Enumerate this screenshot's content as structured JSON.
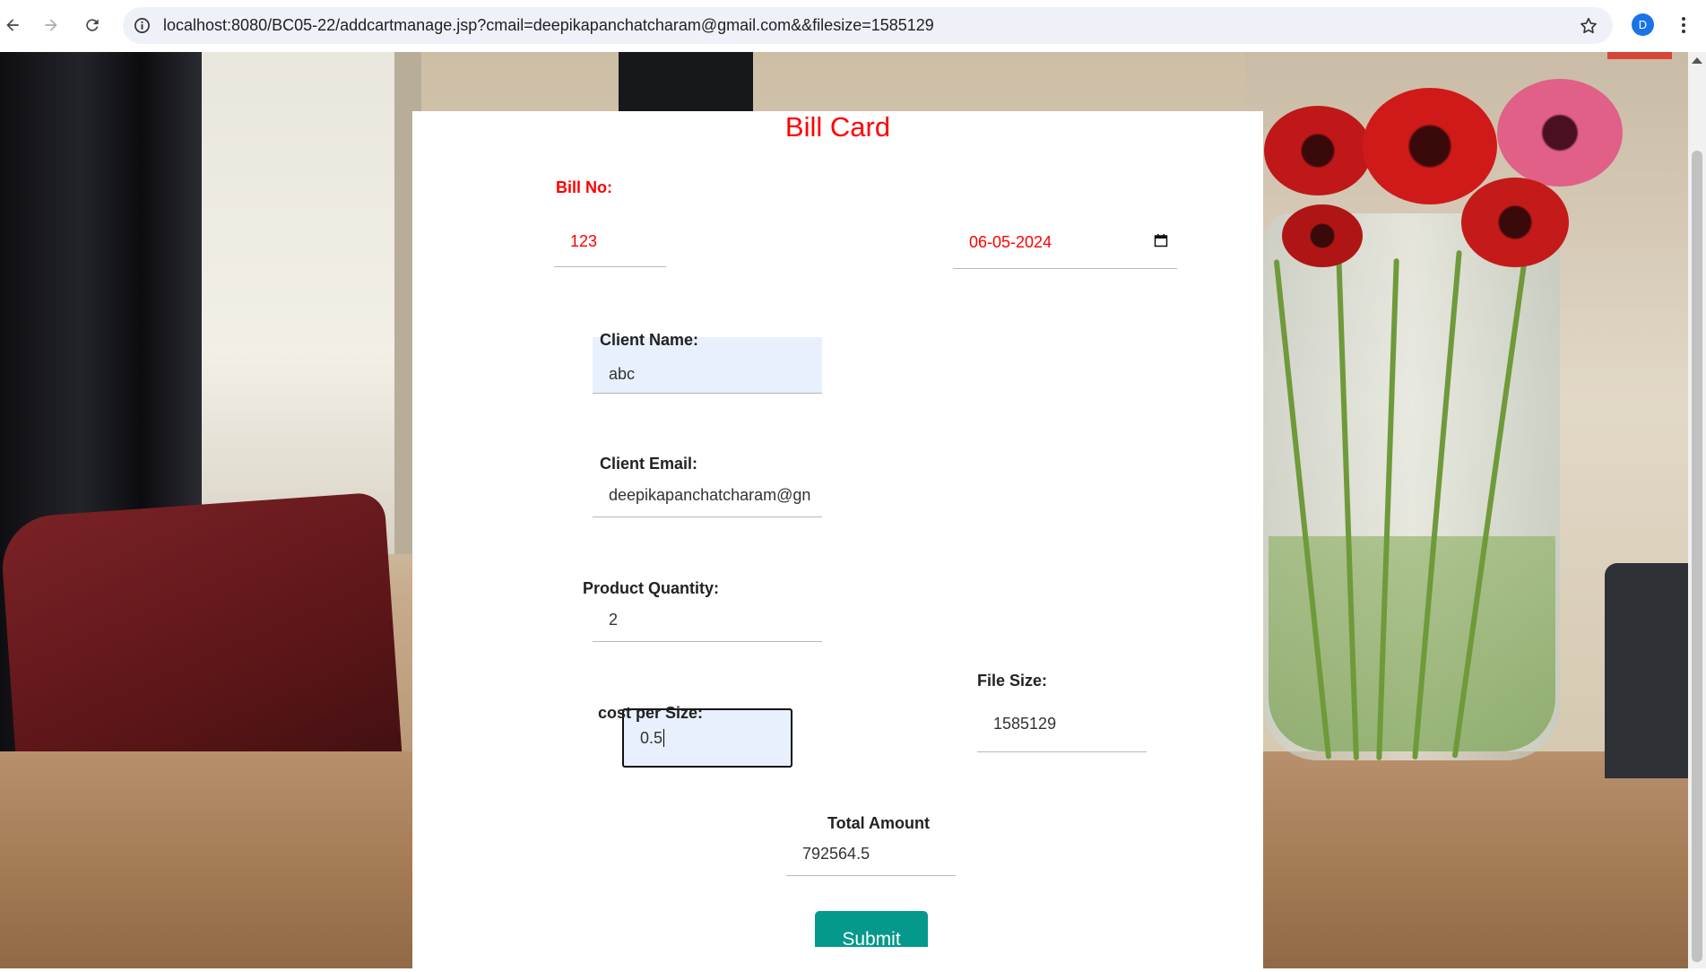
{
  "browser": {
    "url": "localhost:8080/BC05-22/addcartmanage.jsp?cmail=deepikapanchatcharam@gmail.com&&filesize=1585129",
    "profile_initial": "D"
  },
  "form": {
    "title": "Bill Card",
    "bill_no_label": "Bill No:",
    "bill_no_value": "123",
    "date_value": "06-05-2024",
    "client_name_label": "Client Name:",
    "client_name_value": "abc",
    "client_email_label": "Client Email:",
    "client_email_value": "deepikapanchatcharam@gn",
    "product_quantity_label": "Product Quantity:",
    "product_quantity_value": "2",
    "cost_per_size_label": "cost per Size:",
    "cost_per_size_value": "0.5",
    "file_size_label": "File Size:",
    "file_size_value": "1585129",
    "total_amount_label": "Total Amount",
    "total_amount_value": "792564.5",
    "submit_label": "Submit"
  },
  "colors": {
    "title": "#ff0000",
    "submit_bg": "#04998a",
    "autofill_bg": "#e8f0fe"
  }
}
